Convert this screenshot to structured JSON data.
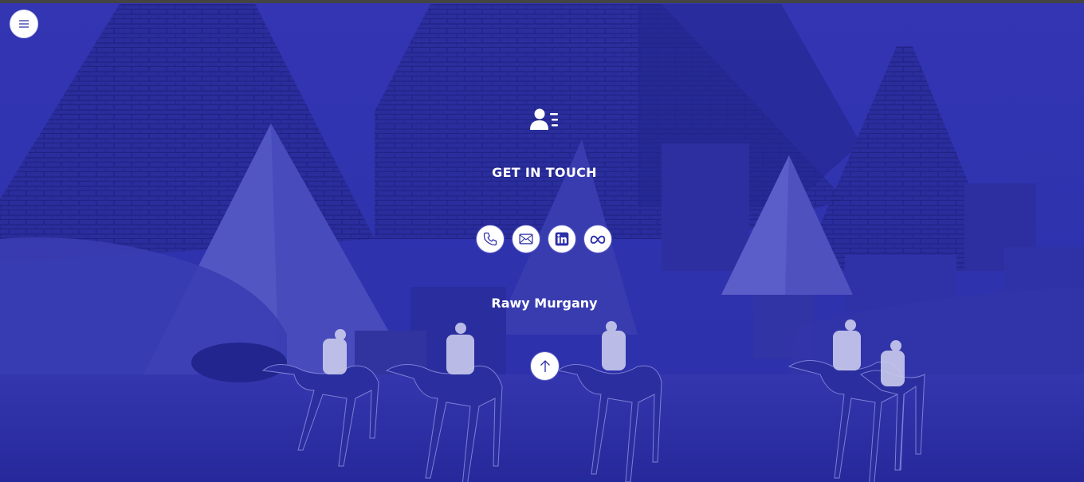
{
  "navigation": {
    "menu_icon": "hamburger-menu-icon"
  },
  "contact": {
    "icon": "contact-card-icon",
    "heading": "GET IN TOUCH",
    "social_links": [
      {
        "name": "phone",
        "icon": "phone-icon"
      },
      {
        "name": "email",
        "icon": "envelope-icon"
      },
      {
        "name": "linkedin",
        "icon": "linkedin-icon"
      },
      {
        "name": "meta",
        "icon": "meta-icon"
      }
    ],
    "author": "Rawy Murgany"
  },
  "back_to_top": {
    "icon": "arrow-up-icon"
  },
  "colors": {
    "overlay": "#2a2da3",
    "accent": "#2b2fa8",
    "text": "#ffffff"
  }
}
